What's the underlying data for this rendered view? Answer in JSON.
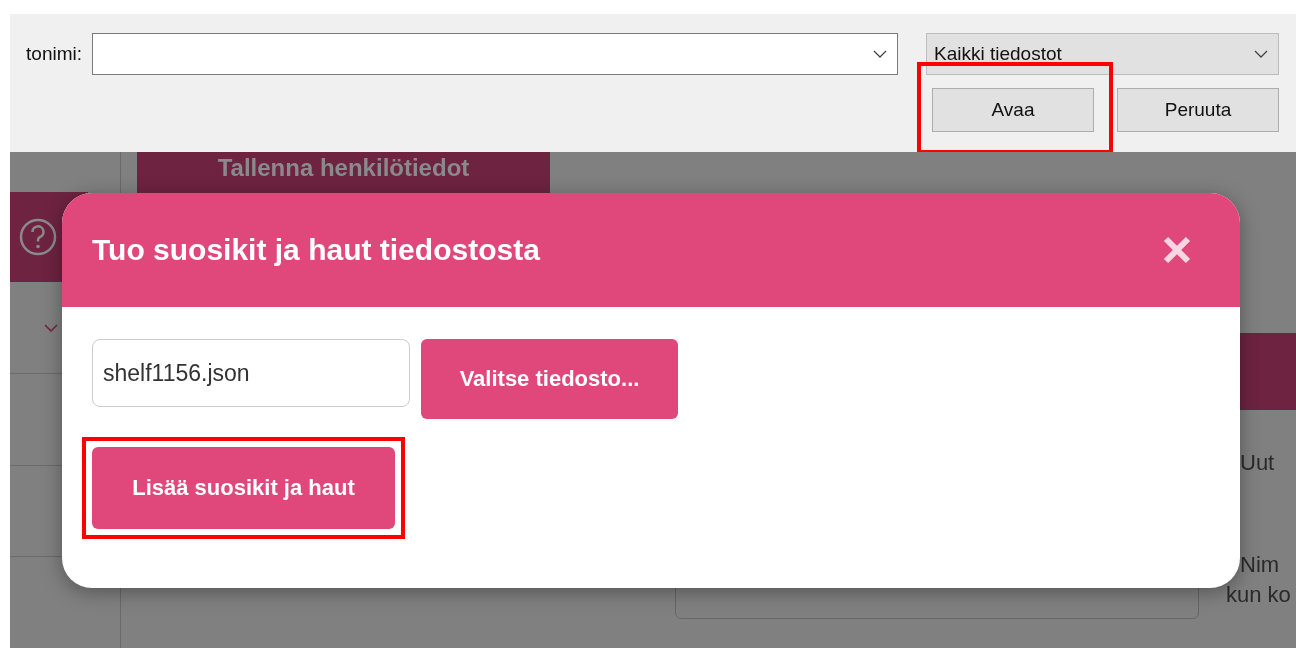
{
  "file_dialog": {
    "filename_label": "tonimi:",
    "filetype": "Kaikki tiedostot",
    "buttons": [
      {
        "label": "Avaa",
        "highlighted": true
      },
      {
        "label": "Peruuta",
        "highlighted": false
      }
    ]
  },
  "background_page": {
    "save_button": "Tallenna henkilötiedot",
    "options": [
      {
        "label": "Uut"
      },
      {
        "label": "Nim",
        "note": "kun ko"
      }
    ]
  },
  "modal": {
    "title": "Tuo suosikit ja haut tiedostosta",
    "file_field": {
      "value": "shelf1156.json"
    },
    "choose_button": {
      "label": "Valitse tiedosto...",
      "highlighted": false
    },
    "add_button": {
      "label": "Lisää suosikit ja haut",
      "highlighted": true
    }
  }
}
